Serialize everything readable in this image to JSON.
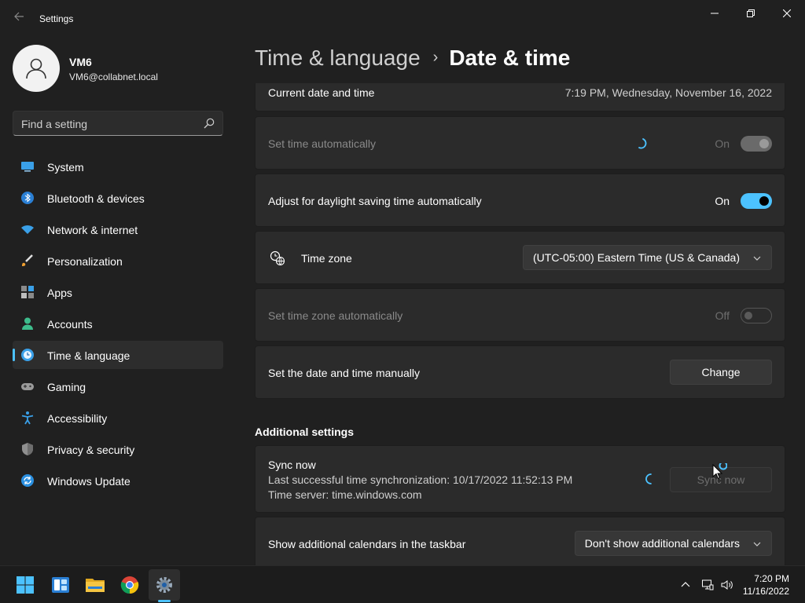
{
  "window": {
    "title": "Settings",
    "back_icon": "back-arrow-icon",
    "controls": [
      "minimize-icon",
      "maximize-icon",
      "close-icon"
    ]
  },
  "profile": {
    "name": "VM6",
    "email": "VM6@collabnet.local",
    "avatar_icon": "person-icon"
  },
  "search": {
    "placeholder": "Find a setting",
    "icon": "search-icon"
  },
  "nav": {
    "items": [
      {
        "label": "System",
        "icon": "system-icon"
      },
      {
        "label": "Bluetooth & devices",
        "icon": "bluetooth-icon"
      },
      {
        "label": "Network & internet",
        "icon": "wifi-icon"
      },
      {
        "label": "Personalization",
        "icon": "brush-icon"
      },
      {
        "label": "Apps",
        "icon": "apps-icon"
      },
      {
        "label": "Accounts",
        "icon": "accounts-icon"
      },
      {
        "label": "Time & language",
        "icon": "time-language-icon",
        "selected": true
      },
      {
        "label": "Gaming",
        "icon": "gamepad-icon"
      },
      {
        "label": "Accessibility",
        "icon": "accessibility-icon"
      },
      {
        "label": "Privacy & security",
        "icon": "shield-icon"
      },
      {
        "label": "Windows Update",
        "icon": "update-icon"
      }
    ]
  },
  "header": {
    "parent": "Time & language",
    "separator": "›",
    "current": "Date & time"
  },
  "settings": {
    "current_datetime": {
      "label": "Current date and time",
      "value": "7:19 PM, Wednesday, November 16, 2022"
    },
    "set_time_auto": {
      "label": "Set time automatically",
      "state": "On",
      "enabled": false,
      "loading": true
    },
    "daylight_saving": {
      "label": "Adjust for daylight saving time automatically",
      "state": "On",
      "enabled": true
    },
    "time_zone": {
      "label": "Time zone",
      "icon": "globe-clock-icon",
      "value": "(UTC-05:00) Eastern Time (US & Canada)"
    },
    "time_zone_auto": {
      "label": "Set time zone automatically",
      "state": "Off",
      "enabled": false
    },
    "manual": {
      "label": "Set the date and time manually",
      "button": "Change"
    }
  },
  "additional": {
    "title": "Additional settings",
    "sync": {
      "label": "Sync now",
      "last_sync": "Last successful time synchronization: 10/17/2022 11:52:13 PM",
      "server": "Time server: time.windows.com",
      "button": "Sync now",
      "button_enabled": false,
      "loading": true
    },
    "calendars": {
      "label": "Show additional calendars in the taskbar",
      "value": "Don't show additional calendars"
    }
  },
  "taskbar": {
    "apps": [
      "start-icon",
      "widgets-icon",
      "file-explorer-icon",
      "chrome-icon",
      "settings-icon"
    ],
    "active_app": "settings-icon",
    "tray": [
      "chevron-up-icon",
      "network-icon",
      "volume-icon"
    ],
    "time": "7:20 PM",
    "date": "11/16/2022"
  },
  "colors": {
    "accent": "#4cc2ff",
    "background": "#202020",
    "card": "#2b2b2b"
  }
}
